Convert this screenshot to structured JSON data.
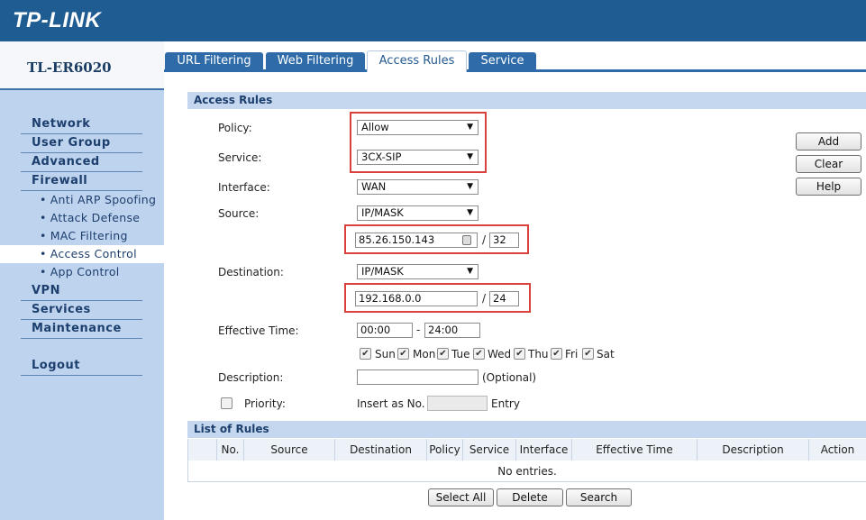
{
  "header": {
    "logo": "TP-LINK"
  },
  "sidebar": {
    "model": "TL-ER6020",
    "items": [
      {
        "label": "Network",
        "type": "nav"
      },
      {
        "label": "User Group",
        "type": "nav"
      },
      {
        "label": "Advanced",
        "type": "nav"
      },
      {
        "label": "Firewall",
        "type": "nav"
      },
      {
        "label": "Anti ARP Spoofing",
        "type": "sub"
      },
      {
        "label": "Attack Defense",
        "type": "sub"
      },
      {
        "label": "MAC Filtering",
        "type": "sub"
      },
      {
        "label": "Access Control",
        "type": "sub",
        "active": true
      },
      {
        "label": "App Control",
        "type": "sub"
      },
      {
        "label": "VPN",
        "type": "nav"
      },
      {
        "label": "Services",
        "type": "nav"
      },
      {
        "label": "Maintenance",
        "type": "nav"
      },
      {
        "label": "Logout",
        "type": "nav"
      }
    ],
    "bullet": "•"
  },
  "tabs": [
    {
      "label": "URL Filtering"
    },
    {
      "label": "Web Filtering"
    },
    {
      "label": "Access Rules",
      "active": true
    },
    {
      "label": "Service"
    }
  ],
  "form": {
    "section_title": "Access Rules",
    "policy": {
      "label": "Policy:",
      "value": "Allow"
    },
    "service": {
      "label": "Service:",
      "value": "3CX-SIP"
    },
    "interface": {
      "label": "Interface:",
      "value": "WAN"
    },
    "source": {
      "label": "Source:",
      "type": "IP/MASK",
      "ip": "85.26.150.143",
      "mask": "32"
    },
    "destination": {
      "label": "Destination:",
      "type": "IP/MASK",
      "ip": "192.168.0.0",
      "mask": "24"
    },
    "slash": "/",
    "effective_time": {
      "label": "Effective Time:",
      "start": "00:00",
      "separator": "-",
      "end": "24:00"
    },
    "days": [
      {
        "label": "Sun",
        "checked": true
      },
      {
        "label": "Mon",
        "checked": true
      },
      {
        "label": "Tue",
        "checked": true
      },
      {
        "label": "Wed",
        "checked": true
      },
      {
        "label": "Thu",
        "checked": true
      },
      {
        "label": "Fri",
        "checked": true
      },
      {
        "label": "Sat",
        "checked": true
      }
    ],
    "description": {
      "label": "Description:",
      "value": "",
      "hint": "(Optional)"
    },
    "priority": {
      "label": "Priority:",
      "checked": false,
      "insert_label": "Insert as No.",
      "value": "",
      "suffix": "Entry"
    }
  },
  "side_buttons": {
    "add": "Add",
    "clear": "Clear",
    "help": "Help"
  },
  "rules": {
    "section_title": "List of Rules",
    "columns": [
      "No.",
      "Source",
      "Destination",
      "Policy",
      "Service",
      "Interface",
      "Effective Time",
      "Description",
      "Action"
    ],
    "empty_text": "No entries."
  },
  "bottom_buttons": {
    "select_all": "Select All",
    "delete": "Delete",
    "search": "Search"
  },
  "symbols": {
    "dropdown_arrow": "▼",
    "check": "✔"
  },
  "colors": {
    "header_bg": "#1f5c92",
    "sidebar_bg": "#bed3ee",
    "tab_bg": "#2e6ba8",
    "highlight": "#d9413a"
  }
}
